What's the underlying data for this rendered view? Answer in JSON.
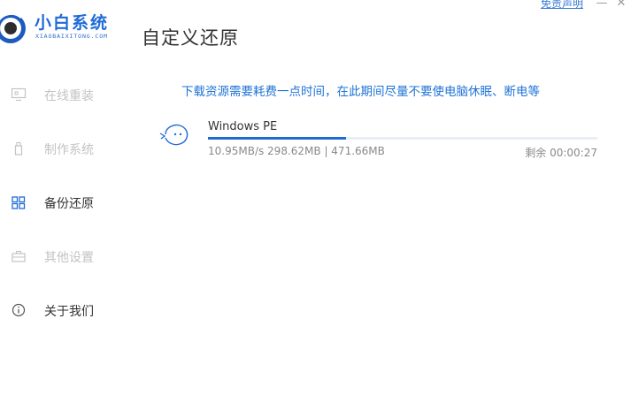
{
  "header": {
    "brand_name": "小白系统",
    "brand_sub": "XIAOBAIXITONG.COM",
    "page_title": "自定义还原",
    "disclaimer": "免责声明",
    "minimize": "—",
    "close": "✕"
  },
  "sidebar": {
    "items": [
      {
        "label": "在线重装",
        "icon": "monitor-icon",
        "state": "disabled"
      },
      {
        "label": "制作系统",
        "icon": "usb-drive-icon",
        "state": "disabled"
      },
      {
        "label": "备份还原",
        "icon": "grid-icon",
        "state": "active"
      },
      {
        "label": "其他设置",
        "icon": "briefcase-icon",
        "state": "disabled"
      },
      {
        "label": "关于我们",
        "icon": "info-icon",
        "state": "normal"
      }
    ]
  },
  "main": {
    "notice": "下载资源需要耗费一点时间，在此期间尽量不要使电脑休眠、断电等",
    "download": {
      "name": "Windows PE",
      "stats": "10.95MB/s 298.62MB | 471.66MB",
      "remaining": "剩余 00:00:27",
      "progress": 0.355
    }
  },
  "colors": {
    "accent": "#1f6bd6",
    "disabled_text": "#c3c3c3"
  }
}
